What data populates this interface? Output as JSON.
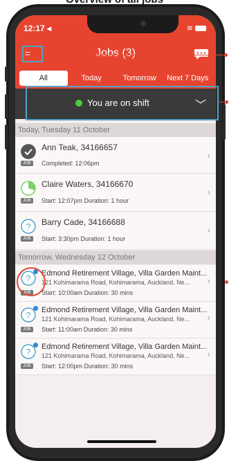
{
  "caption": "Overview of all jobs",
  "status": {
    "time": "12:17 ◂"
  },
  "header": {
    "title": "Jobs (3)"
  },
  "tabs": [
    "All",
    "Today",
    "Tomorrow",
    "Next 7 Days"
  ],
  "shift": {
    "label": "You are on shift"
  },
  "sections": [
    {
      "label": "Today, Tuesday 11 October"
    },
    {
      "label": "Tomorrow, Wednesday 12 October"
    }
  ],
  "jobs": [
    {
      "name": "Ann Teak, 34166657",
      "meta": "Completed: 12:06pm",
      "badge": "JOB"
    },
    {
      "name": "Claire Waters, 34166670",
      "meta": "Start: 12:07pm  Duration: 1 hour",
      "badge": "JOB"
    },
    {
      "name": "Barry Cade, 34166688",
      "meta": "Start: 3:30pm  Duration: 1 hour",
      "badge": "JOB"
    },
    {
      "name": "Edmond Retirement Village, Villa Garden Maint...",
      "address": "121 Kohimarama Road, Kohimarama, Auckland, Ne...",
      "meta": "Start: 10:00am  Duration: 30 mins",
      "badge": "JOB"
    },
    {
      "name": "Edmond Retirement Village, Villa Garden Maint...",
      "address": "121 Kohimarama Road, Kohimarama, Auckland, Ne...",
      "meta": "Start: 11:00am  Duration: 30 mins",
      "badge": "JOB"
    },
    {
      "name": "Edmond Retirement Village, Villa Garden Maint...",
      "address": "121 Kohimarama Road, Kohimarama, Auckland, Ne...",
      "meta": "Start: 12:00pm  Duration: 30 mins",
      "badge": "JOB"
    }
  ],
  "colors": {
    "accent": "#e74430",
    "shift_bar": "#3a3a3a",
    "on_shift": "#4ccb3e",
    "callout_box": "#4fa3c7"
  }
}
